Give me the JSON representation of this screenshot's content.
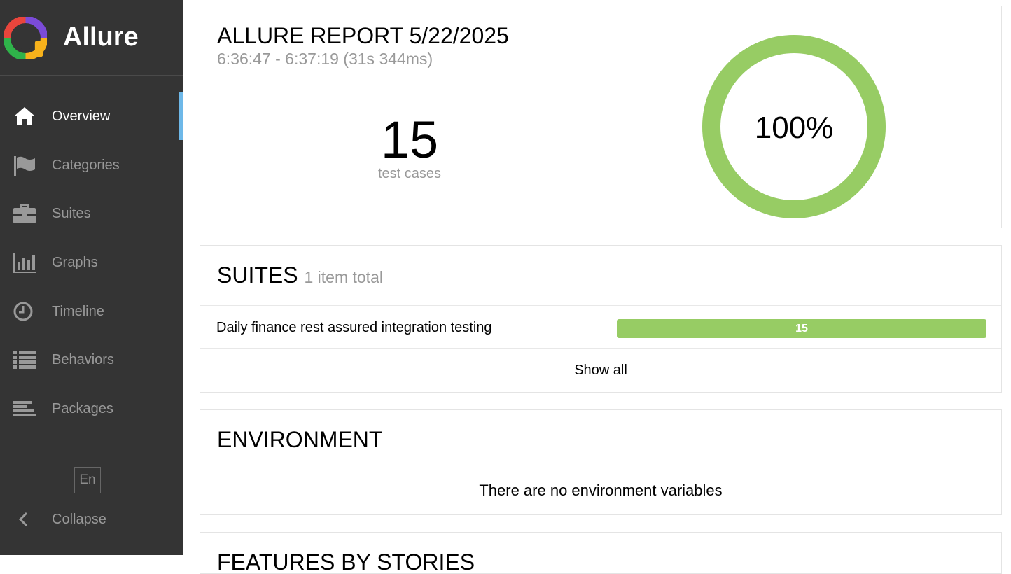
{
  "brand": {
    "name": "Allure"
  },
  "sidebar": {
    "items": [
      {
        "label": "Overview",
        "icon": "home-icon",
        "active": true
      },
      {
        "label": "Categories",
        "icon": "flag-icon",
        "active": false
      },
      {
        "label": "Suites",
        "icon": "briefcase-icon",
        "active": false
      },
      {
        "label": "Graphs",
        "icon": "bar-chart-icon",
        "active": false
      },
      {
        "label": "Timeline",
        "icon": "clock-icon",
        "active": false
      },
      {
        "label": "Behaviors",
        "icon": "list-icon",
        "active": false
      },
      {
        "label": "Packages",
        "icon": "align-left-icon",
        "active": false
      }
    ],
    "language": "En",
    "collapse_label": "Collapse"
  },
  "summary": {
    "title": "ALLURE REPORT 5/22/2025",
    "time_range": "6:36:47 - 6:37:19 (31s 344ms)",
    "test_count": "15",
    "test_count_label": "test cases",
    "pass_rate": "100%",
    "pass_fraction": 1.0,
    "pass_color": "#97cc64"
  },
  "suites": {
    "title": "SUITES",
    "total": "1 item total",
    "rows": [
      {
        "name": "Daily finance rest assured integration testing",
        "passed": "15"
      }
    ],
    "show_all": "Show all"
  },
  "environment": {
    "title": "ENVIRONMENT",
    "empty_message": "There are no environment variables"
  },
  "features": {
    "title": "FEATURES BY STORIES"
  },
  "colors": {
    "sidebar_bg": "#343434",
    "active_indicator": "#6eb8e8",
    "passed": "#97cc64"
  }
}
